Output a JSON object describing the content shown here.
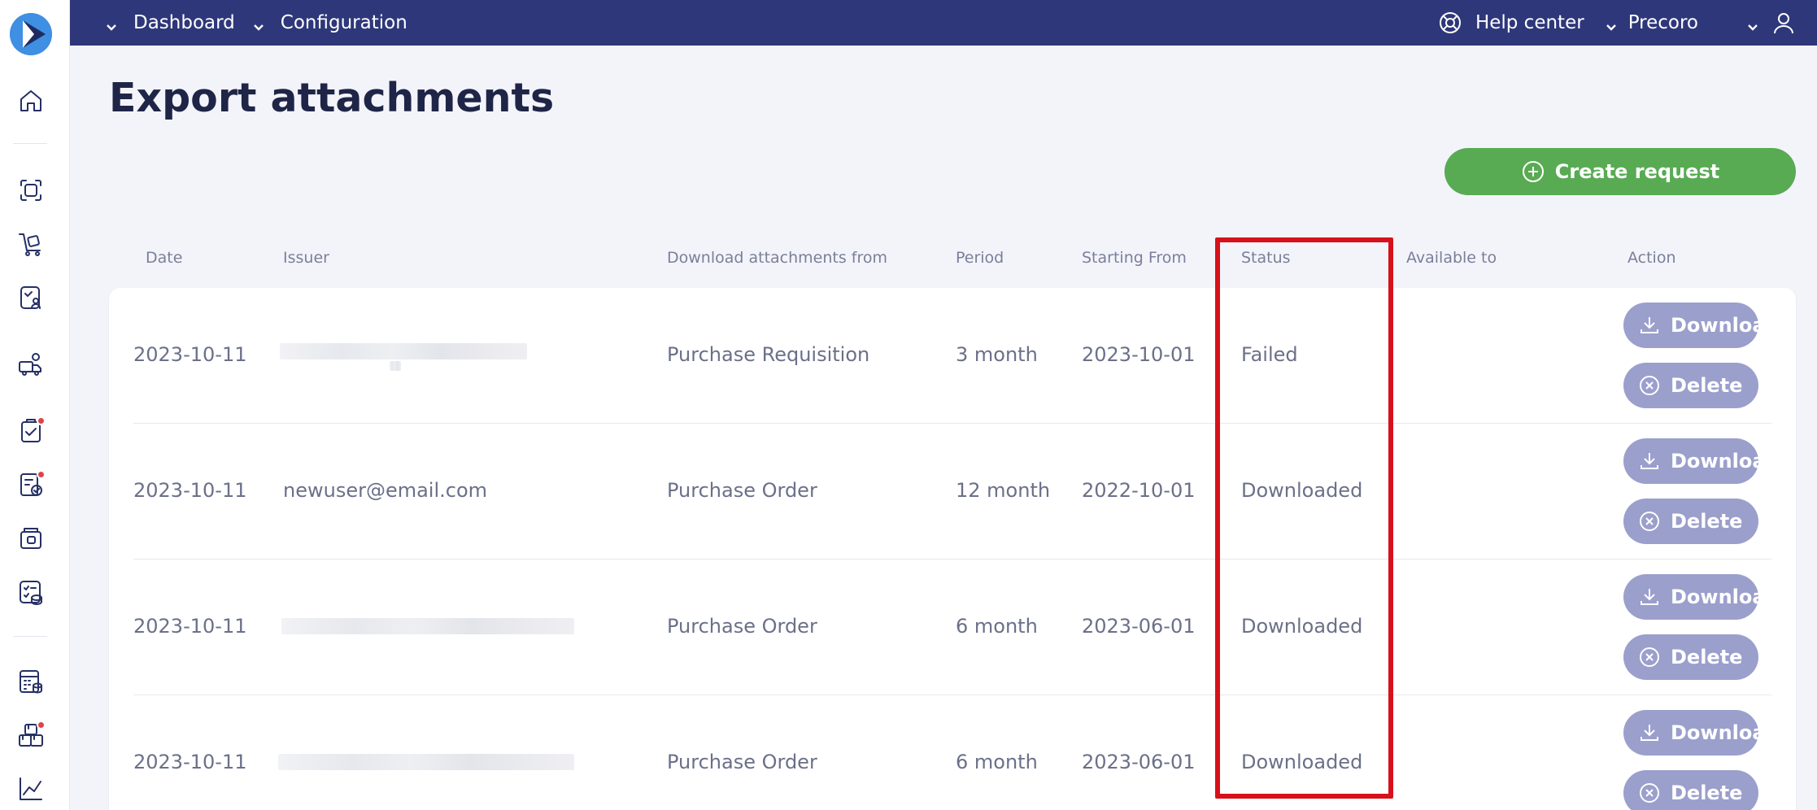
{
  "topbar": {
    "nav": [
      {
        "label": "Dashboard",
        "icon": "chevron-down-icon"
      },
      {
        "label": "Configuration",
        "icon": "chevron-down-icon"
      }
    ],
    "help_label": "Help center",
    "company_label": "Precoro",
    "bg_color": "#2e3779"
  },
  "sidebar": {
    "items": [
      {
        "name": "home-icon"
      },
      {
        "name": "scan-icon"
      },
      {
        "name": "cart-icon"
      },
      {
        "name": "approval-icon"
      },
      {
        "name": "supplier-icon"
      },
      {
        "name": "clipboard-check-icon",
        "badge": true
      },
      {
        "name": "document-check-icon",
        "badge": true
      },
      {
        "name": "wallet-icon"
      },
      {
        "name": "list-check-icon"
      },
      {
        "name": "calculator-icon"
      },
      {
        "name": "boxes-icon",
        "badge": true
      },
      {
        "name": "analytics-icon"
      }
    ]
  },
  "page": {
    "title": "Export attachments",
    "create_label": "Create request",
    "create_color": "#58ab53"
  },
  "table": {
    "headers": {
      "date": "Date",
      "issuer": "Issuer",
      "from": "Download attachments from",
      "period": "Period",
      "start": "Starting From",
      "status": "Status",
      "available": "Available to",
      "action": "Action"
    },
    "download_label": "Download",
    "delete_label": "Delete",
    "button_color": "#9b9fcc",
    "rows": [
      {
        "date": "2023-10-11",
        "issuer": "",
        "issuer_blurred": true,
        "from": "Purchase Requisition",
        "period": "3 month",
        "start": "2023-10-01",
        "status": "Failed",
        "available": ""
      },
      {
        "date": "2023-10-11",
        "issuer": "newuser@email.com",
        "issuer_blurred": false,
        "from": "Purchase Order",
        "period": "12 month",
        "start": "2022-10-01",
        "status": "Downloaded",
        "available": ""
      },
      {
        "date": "2023-10-11",
        "issuer": "",
        "issuer_blurred": true,
        "from": "Purchase Order",
        "period": "6 month",
        "start": "2023-06-01",
        "status": "Downloaded",
        "available": ""
      },
      {
        "date": "2023-10-11",
        "issuer": "",
        "issuer_blurred": true,
        "from": "Purchase Order",
        "period": "6 month",
        "start": "2023-06-01",
        "status": "Downloaded",
        "available": ""
      }
    ]
  },
  "highlight_color": "#d7111a"
}
